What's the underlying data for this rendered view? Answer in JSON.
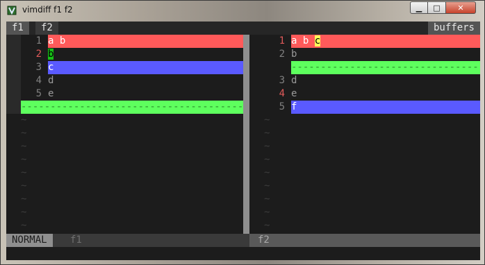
{
  "window": {
    "title": "vimdiff f1 f2",
    "buttons": {
      "minimize": "▁",
      "maximize": "□",
      "close": "✕"
    },
    "icon": "vim-app-icon"
  },
  "tabline": {
    "tabs": [
      {
        "label": "f1"
      },
      {
        "label": "f2"
      }
    ],
    "buffers_label": "buffers"
  },
  "left_pane": {
    "lines": [
      {
        "num": "1",
        "text": "a b",
        "state": "changed"
      },
      {
        "num": "2",
        "text": "b",
        "state": "changed-inline-green"
      },
      {
        "num": "3",
        "text": "c",
        "state": "added"
      },
      {
        "num": "4",
        "text": "d",
        "state": "normal"
      },
      {
        "num": "5",
        "text": "e",
        "state": "normal"
      }
    ],
    "filler": "----------------------------------------------",
    "tildes": [
      "~",
      "~",
      "~",
      "~",
      "~",
      "~",
      "~",
      "~",
      "~",
      "~"
    ]
  },
  "right_pane": {
    "lines": [
      {
        "num": "1",
        "text_prefix": "a b ",
        "text_hl": "c",
        "state": "changed"
      },
      {
        "num": "2",
        "text": "b",
        "state": "normal"
      },
      {
        "filler": "-------------------------------------------"
      },
      {
        "num": "3",
        "text": "d",
        "state": "normal"
      },
      {
        "num": "4",
        "text": "e",
        "state": "changed-num"
      },
      {
        "num": "5",
        "text": "f",
        "state": "added"
      }
    ],
    "tildes": [
      "~",
      "~",
      "~",
      "~",
      "~",
      "~",
      "~",
      "~",
      "~"
    ]
  },
  "statusline": {
    "mode": "NORMAL",
    "left_file": "f1",
    "right_file": "f2"
  },
  "colors": {
    "diff_change": "#ff5a5a",
    "diff_add": "#5a5aff",
    "diff_filler": "#5eff5e",
    "diff_text_hl": "#ffff5a",
    "changed_linenr": "#e05a5a"
  }
}
